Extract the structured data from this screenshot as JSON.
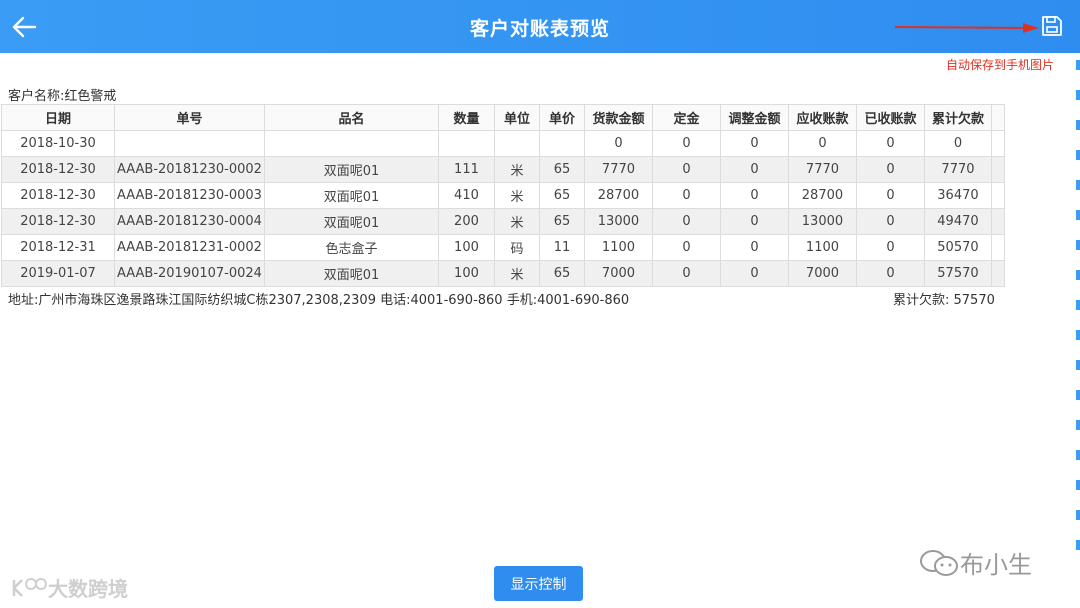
{
  "header": {
    "title": "客户对账表预览",
    "back_icon": "arrow-left-icon",
    "save_icon": "save-floppy-icon",
    "background": "#3a9cf4"
  },
  "annotation": {
    "text": "自动保存到手机图片",
    "color": "#e03020"
  },
  "customer": {
    "label": "客户名称:红色警戒"
  },
  "table": {
    "columns": [
      "日期",
      "单号",
      "品名",
      "数量",
      "单位",
      "单价",
      "货款金额",
      "定金",
      "调整金额",
      "应收账款",
      "已收账款",
      "累计欠款",
      ""
    ],
    "rows": [
      [
        "2018-10-30",
        "",
        "",
        "",
        "",
        "",
        "0",
        "0",
        "0",
        "0",
        "0",
        "0",
        ""
      ],
      [
        "2018-12-30",
        "AAAB-20181230-0002",
        "双面呢01",
        "111",
        "米",
        "65",
        "7770",
        "0",
        "0",
        "7770",
        "0",
        "7770",
        ""
      ],
      [
        "2018-12-30",
        "AAAB-20181230-0003",
        "双面呢01",
        "410",
        "米",
        "65",
        "28700",
        "0",
        "0",
        "28700",
        "0",
        "36470",
        ""
      ],
      [
        "2018-12-30",
        "AAAB-20181230-0004",
        "双面呢01",
        "200",
        "米",
        "65",
        "13000",
        "0",
        "0",
        "13000",
        "0",
        "49470",
        ""
      ],
      [
        "2018-12-31",
        "AAAB-20181231-0002",
        "色志盒子",
        "100",
        "码",
        "11",
        "1100",
        "0",
        "0",
        "1100",
        "0",
        "50570",
        ""
      ],
      [
        "2019-01-07",
        "AAAB-20190107-0024",
        "双面呢01",
        "100",
        "米",
        "65",
        "7000",
        "0",
        "0",
        "7000",
        "0",
        "57570",
        ""
      ]
    ]
  },
  "footer": {
    "address": "地址:广州市海珠区逸景路珠江国际纺织城C栋2307,2308,2309 电话:4001-690-860 手机:4001-690-860",
    "total": "累计欠款: 57570"
  },
  "control_button": {
    "label": "显示控制",
    "color": "#2f8df0"
  },
  "watermarks": {
    "left": "大数跨境",
    "right": "布小生"
  }
}
